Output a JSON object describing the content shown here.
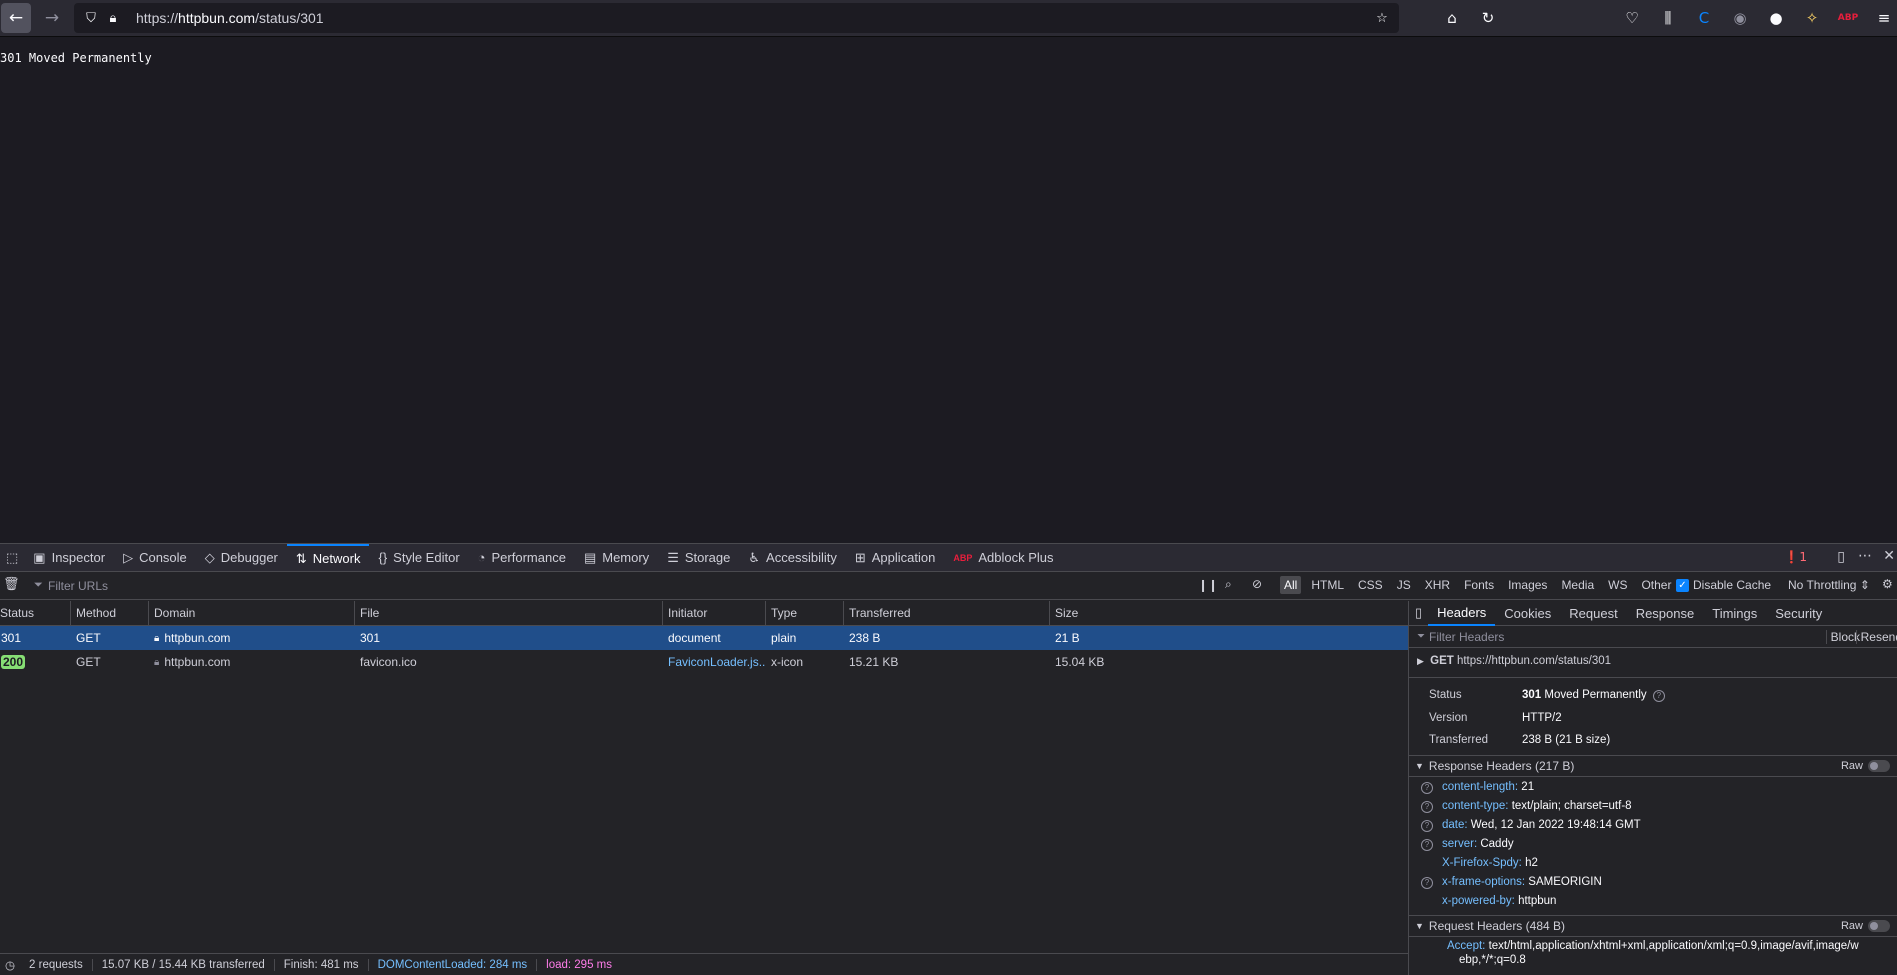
{
  "browser": {
    "url_base": "https://",
    "url_host": "httpbun.com",
    "url_path": "/status/301"
  },
  "page": {
    "body_text": "301 Moved Permanently"
  },
  "devtools": {
    "tabs": [
      {
        "label": "Inspector",
        "icon": "inspector-icon"
      },
      {
        "label": "Console",
        "icon": "console-icon"
      },
      {
        "label": "Debugger",
        "icon": "debugger-icon"
      },
      {
        "label": "Network",
        "icon": "network-icon"
      },
      {
        "label": "Style Editor",
        "icon": "style-editor-icon"
      },
      {
        "label": "Performance",
        "icon": "performance-icon"
      },
      {
        "label": "Memory",
        "icon": "memory-icon"
      },
      {
        "label": "Storage",
        "icon": "storage-icon"
      },
      {
        "label": "Accessibility",
        "icon": "accessibility-icon"
      },
      {
        "label": "Application",
        "icon": "application-icon"
      },
      {
        "label": "Adblock Plus",
        "icon": "abp-icon"
      }
    ],
    "error_count": "1",
    "filter_placeholder": "Filter URLs",
    "type_filters": [
      "All",
      "HTML",
      "CSS",
      "JS",
      "XHR",
      "Fonts",
      "Images",
      "Media",
      "WS",
      "Other"
    ],
    "disable_cache": "Disable Cache",
    "throttling": "No Throttling",
    "columns": [
      "Status",
      "Method",
      "Domain",
      "File",
      "Initiator",
      "Type",
      "Transferred",
      "Size"
    ],
    "rows": [
      {
        "status": "301",
        "method": "GET",
        "domain": "httpbun.com",
        "file": "301",
        "initiator": "document",
        "type": "plain",
        "transferred": "238 B",
        "size": "21 B"
      },
      {
        "status": "200",
        "method": "GET",
        "domain": "httpbun.com",
        "file": "favicon.ico",
        "initiator": "FaviconLoader.js...",
        "type": "x-icon",
        "transferred": "15.21 KB",
        "size": "15.04 KB"
      }
    ],
    "status_bar": {
      "requests": "2 requests",
      "transferred": "15.07 KB / 15.44 KB transferred",
      "finish": "Finish: 481 ms",
      "dcl": "DOMContentLoaded: 284 ms",
      "load": "load: 295 ms"
    },
    "side": {
      "tabs": [
        "Headers",
        "Cookies",
        "Request",
        "Response",
        "Timings",
        "Security"
      ],
      "filter_placeholder": "Filter Headers",
      "block": "Block",
      "resend": "Resend",
      "summary_method": "GET",
      "summary_url": "https://httpbun.com/status/301",
      "status_label": "Status",
      "status_code": "301",
      "status_text": "Moved Permanently",
      "version_label": "Version",
      "version": "HTTP/2",
      "transferred_label": "Transferred",
      "transferred": "238 B (21 B size)",
      "response_headers_title": "Response Headers (217 B)",
      "raw": "Raw",
      "response_headers": [
        {
          "k": "content-length:",
          "v": "21",
          "help": true
        },
        {
          "k": "content-type:",
          "v": "text/plain; charset=utf-8",
          "help": true
        },
        {
          "k": "date:",
          "v": "Wed, 12 Jan 2022 19:48:14 GMT",
          "help": true
        },
        {
          "k": "server:",
          "v": "Caddy",
          "help": true
        },
        {
          "k": "X-Firefox-Spdy:",
          "v": "h2",
          "help": false
        },
        {
          "k": "x-frame-options:",
          "v": "SAMEORIGIN",
          "help": true
        },
        {
          "k": "x-powered-by:",
          "v": "httpbun",
          "help": false
        }
      ],
      "request_headers_title": "Request Headers (484 B)",
      "accept_key": "Accept:",
      "accept_val": "text/html,application/xhtml+xml,application/xml;q=0.9,image/avif,image/w",
      "accept_val2": "ebp,*/*;q=0.8"
    }
  }
}
